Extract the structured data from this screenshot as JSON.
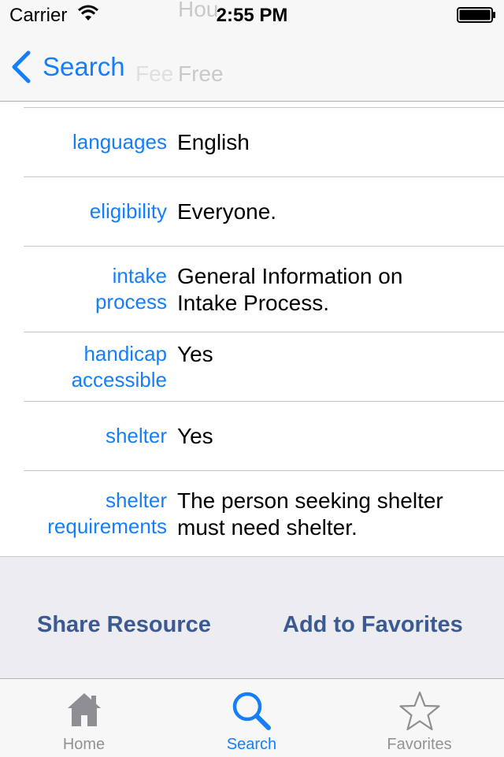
{
  "status_bar": {
    "carrier": "Carrier",
    "time": "2:55 PM"
  },
  "nav": {
    "back_label": "Search",
    "ghost_text": [
      "Hou",
      "Free",
      "Fee"
    ]
  },
  "details": [
    {
      "label": "languages",
      "value": "English"
    },
    {
      "label": "eligibility",
      "value": "Everyone."
    },
    {
      "label": "intake process",
      "value": "General Information on Intake Process."
    },
    {
      "label": "handicap accessible",
      "value": "Yes"
    },
    {
      "label": "shelter",
      "value": "Yes"
    },
    {
      "label": "shelter requirements",
      "value": "The person seeking shelter must need shelter."
    }
  ],
  "actions": {
    "share_label": "Share Resource",
    "favorite_label": "Add to Favorites"
  },
  "tabs": [
    {
      "label": "Home",
      "icon": "home-icon",
      "active": false
    },
    {
      "label": "Search",
      "icon": "search-icon",
      "active": true
    },
    {
      "label": "Favorites",
      "icon": "star-icon",
      "active": false
    }
  ],
  "colors": {
    "accent": "#157efb",
    "action_text": "#3c5a92",
    "inactive_tab": "#929292"
  }
}
